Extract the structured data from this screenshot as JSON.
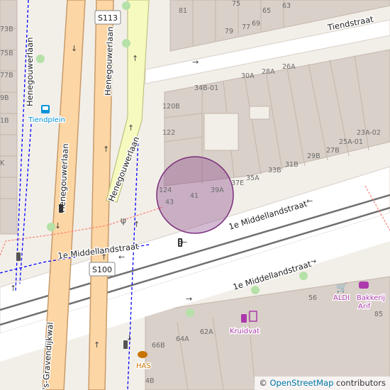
{
  "map": {
    "streets": {
      "tiendstraat": "Tiendstraat",
      "middellandstraat_north": "1e Middellandstraat",
      "middellandstraat_south": "1e Middellandstraat",
      "middellandstraat_west": "1e Middellandstraat",
      "henegouwerlaan_left": "Henegouwerlaan",
      "henegouwerlaan_right": "Henegouwerlaan",
      "henegouwerlaan_diag": "Henegouwerlaan",
      "henegouwerlaan_side": "Henegouwerlaan",
      "gravendijkwal": "'s-Gravendijkwal"
    },
    "route_shields": {
      "s113": "S113",
      "s100": "S100"
    },
    "pois": {
      "tiendplein": "Tiendplein",
      "aldi": "ALDI",
      "bakkerij": [
        "Bakkerij",
        "Arif"
      ],
      "kruidvat": "Kruidvat",
      "has": "HAS"
    },
    "house_numbers": {
      "n81": "81",
      "n75": "75",
      "n65": "65",
      "n63": "63",
      "n79": "79",
      "n77": "77",
      "n69": "69",
      "n30a": "30A",
      "n28a": "28A",
      "n26a": "26A",
      "n34b01": "34B-01",
      "n120b": "120B",
      "n122": "122",
      "n124": "124",
      "n43": "43",
      "n41": "41",
      "n39a": "39A",
      "n37e": "37E",
      "n35a": "35A",
      "n33b": "33B",
      "n31b": "31B",
      "n29b": "29B",
      "n27b": "27B",
      "n25a01": "25A-01",
      "n23a02": "23A-02",
      "n56": "56",
      "n85": "85",
      "n62a": "62A",
      "n64a": "64A",
      "n66b": "66B",
      "n4b": "4B",
      "w73b": "73B",
      "w75b": "75B",
      "w77b": "77B",
      "w79b": "9B",
      "w81b": "1B",
      "wk": "K"
    },
    "attribution": {
      "prefix": "© ",
      "link": "OpenStreetMap",
      "suffix": " contributors"
    },
    "colors": {
      "land": "#f2efe9",
      "building": "#d9d0c9",
      "building_stroke": "#c4b6ab",
      "road_white": "#ffffff",
      "trunk": "#fcd6a4",
      "trunk_casing": "#c99b6a",
      "busway": "#f7fabf",
      "rail": "#707070",
      "footway": "#fa8072",
      "bus_dash": "#0000ff",
      "marker_fill": "rgba(128,58,128,0.35)",
      "marker_stroke": "#7b2e7b",
      "poi_purple": "#ac39ac",
      "poi_orange": "#c77400",
      "tree": "#b5e1a8",
      "bus_blue": "#0092da"
    }
  }
}
